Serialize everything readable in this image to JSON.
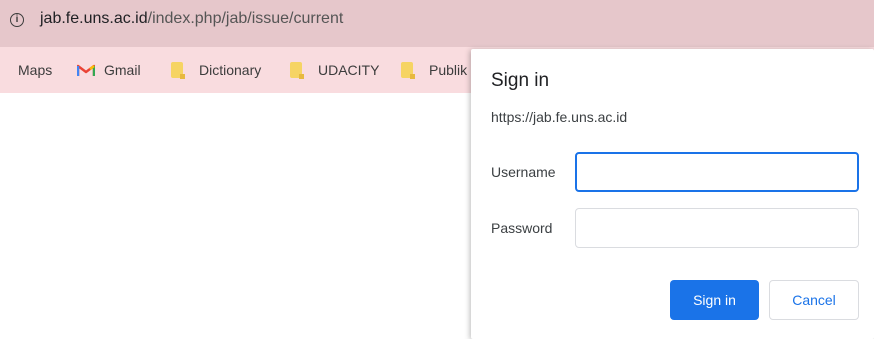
{
  "address_bar": {
    "url_host": "jab.fe.uns.ac.id",
    "url_path": "/index.php/jab/issue/current",
    "info_icon": "info-icon",
    "background_color": "#e6c7cb"
  },
  "bookmarks_bar": {
    "background_color": "#f9dcdf",
    "items": [
      {
        "label": "Maps",
        "icon": "none"
      },
      {
        "label": "Gmail",
        "icon": "gmail-icon"
      },
      {
        "label": "Dictionary",
        "icon": "folder-icon"
      },
      {
        "label": "UDACITY",
        "icon": "folder-icon"
      },
      {
        "label": "Publik",
        "icon": "folder-icon"
      }
    ]
  },
  "dialog": {
    "title": "Sign in",
    "origin": "https://jab.fe.uns.ac.id",
    "username_label": "Username",
    "username_value": "",
    "password_label": "Password",
    "password_value": "",
    "sign_in_label": "Sign in",
    "cancel_label": "Cancel",
    "accent_color": "#1a73e8"
  }
}
